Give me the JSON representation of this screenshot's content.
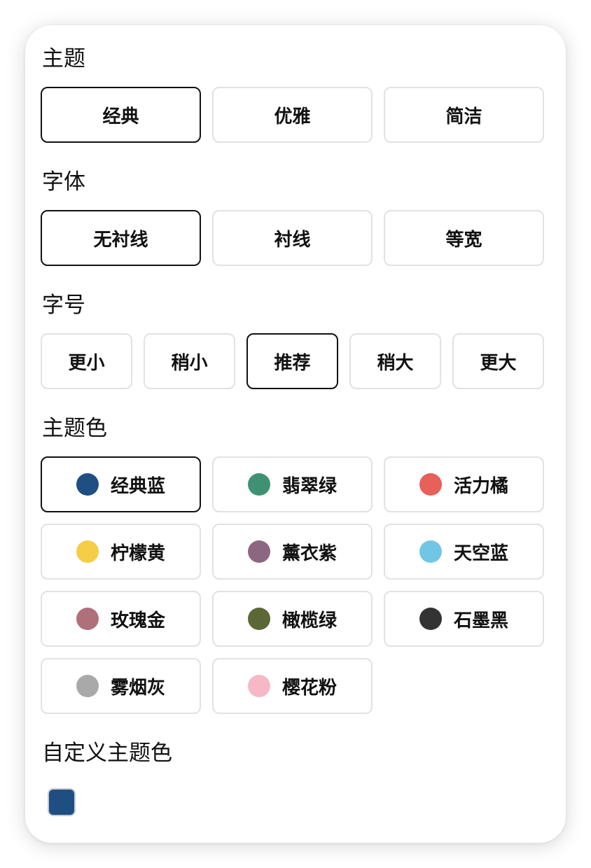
{
  "theme": {
    "title": "主题",
    "options": [
      {
        "label": "经典",
        "selected": true
      },
      {
        "label": "优雅",
        "selected": false
      },
      {
        "label": "简洁",
        "selected": false
      }
    ]
  },
  "font": {
    "title": "字体",
    "options": [
      {
        "label": "无衬线",
        "selected": true
      },
      {
        "label": "衬线",
        "selected": false
      },
      {
        "label": "等宽",
        "selected": false
      }
    ]
  },
  "font_size": {
    "title": "字号",
    "options": [
      {
        "label": "更小",
        "selected": false
      },
      {
        "label": "稍小",
        "selected": false
      },
      {
        "label": "推荐",
        "selected": true
      },
      {
        "label": "稍大",
        "selected": false
      },
      {
        "label": "更大",
        "selected": false
      }
    ]
  },
  "theme_color": {
    "title": "主题色",
    "options": [
      {
        "label": "经典蓝",
        "color": "#1f4e82",
        "selected": true
      },
      {
        "label": "翡翠绿",
        "color": "#3f9174",
        "selected": false
      },
      {
        "label": "活力橘",
        "color": "#e8605a",
        "selected": false
      },
      {
        "label": "柠檬黄",
        "color": "#f6cd47",
        "selected": false
      },
      {
        "label": "薰衣紫",
        "color": "#8d6780",
        "selected": false
      },
      {
        "label": "天空蓝",
        "color": "#72c6e5",
        "selected": false
      },
      {
        "label": "玫瑰金",
        "color": "#b07079",
        "selected": false
      },
      {
        "label": "橄榄绿",
        "color": "#5b6734",
        "selected": false
      },
      {
        "label": "石墨黑",
        "color": "#333333",
        "selected": false
      },
      {
        "label": "雾烟灰",
        "color": "#a9a9a9",
        "selected": false
      },
      {
        "label": "樱花粉",
        "color": "#f6b8c7",
        "selected": false
      }
    ]
  },
  "custom_color": {
    "title": "自定义主题色",
    "value": "#1f4e82"
  }
}
